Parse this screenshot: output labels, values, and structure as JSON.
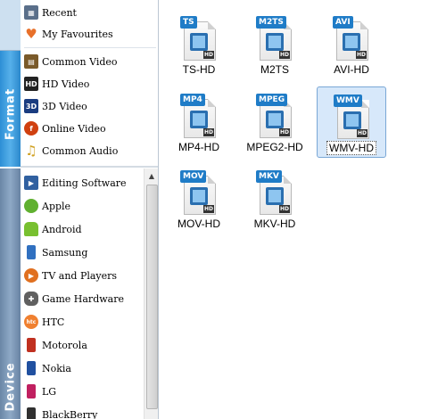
{
  "tabs": {
    "format": "Format",
    "device": "Device"
  },
  "categories": [
    {
      "label": "Recent",
      "icon": "recent-icon",
      "color": "#5a6f8a"
    },
    {
      "label": "My Favourites",
      "icon": "heart-icon",
      "color": "#e8702a"
    },
    {
      "label": "Common Video",
      "icon": "film-icon",
      "color": "#7a5a2a"
    },
    {
      "label": "HD Video",
      "icon": "hd-icon",
      "color": "#222222"
    },
    {
      "label": "3D Video",
      "icon": "3d-icon",
      "color": "#1a3c80"
    },
    {
      "label": "Online Video",
      "icon": "flash-icon",
      "color": "#d04010"
    },
    {
      "label": "Common Audio",
      "icon": "music-note-icon",
      "color": "#d0a020"
    }
  ],
  "devices": [
    {
      "label": "Editing Software",
      "icon": "editing-software-icon",
      "color": "#3060a0"
    },
    {
      "label": "Apple",
      "icon": "apple-icon",
      "color": "#60b030"
    },
    {
      "label": "Android",
      "icon": "android-icon",
      "color": "#78c030"
    },
    {
      "label": "Samsung",
      "icon": "samsung-icon",
      "color": "#3070c0"
    },
    {
      "label": "TV and Players",
      "icon": "tv-players-icon",
      "color": "#e07020"
    },
    {
      "label": "Game Hardware",
      "icon": "game-hardware-icon",
      "color": "#606060"
    },
    {
      "label": "HTC",
      "icon": "htc-icon",
      "color": "#f08030"
    },
    {
      "label": "Motorola",
      "icon": "motorola-icon",
      "color": "#c03020"
    },
    {
      "label": "Nokia",
      "icon": "nokia-icon",
      "color": "#2050a0"
    },
    {
      "label": "LG",
      "icon": "lg-icon",
      "color": "#c02060"
    },
    {
      "label": "BlackBerry",
      "icon": "blackberry-icon",
      "color": "#303030"
    }
  ],
  "formats": [
    {
      "label": "TS-HD",
      "tag": "TS"
    },
    {
      "label": "M2TS",
      "tag": "M2TS"
    },
    {
      "label": "AVI-HD",
      "tag": "AVI"
    },
    {
      "label": "MP4-HD",
      "tag": "MP4"
    },
    {
      "label": "MPEG2-HD",
      "tag": "MPEG"
    },
    {
      "label": "WMV-HD",
      "tag": "WMV"
    },
    {
      "label": "MOV-HD",
      "tag": "MOV"
    },
    {
      "label": "MKV-HD",
      "tag": "MKV"
    }
  ],
  "hd_badge": "HD",
  "selected_format": "WMV-HD"
}
